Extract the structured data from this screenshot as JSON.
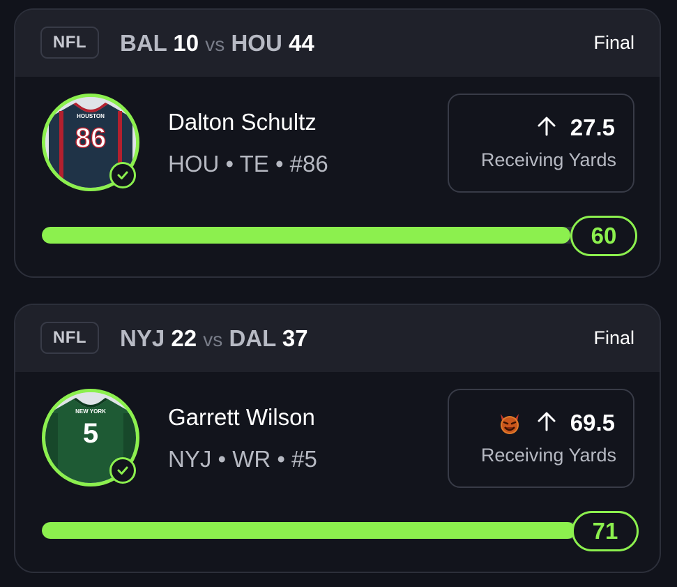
{
  "picks": [
    {
      "league": "NFL",
      "away_team": "BAL",
      "away_score": "10",
      "vs": "vs",
      "home_team": "HOU",
      "home_score": "44",
      "status": "Final",
      "player_name": "Dalton Schultz",
      "player_meta": "HOU • TE • #86",
      "jersey_text": "HOUSTON",
      "jersey_number": "86",
      "jersey_color": "#1f3347",
      "direction_icon": "arrow-up-icon",
      "line": "27.5",
      "stat": "Receiving Yards",
      "result": "60",
      "progress": 0.96,
      "has_emoji": false
    },
    {
      "league": "NFL",
      "away_team": "NYJ",
      "away_score": "22",
      "vs": "vs",
      "home_team": "DAL",
      "home_score": "37",
      "status": "Final",
      "player_name": "Garrett Wilson",
      "player_meta": "NYJ • WR • #5",
      "jersey_text": "NEW YORK",
      "jersey_number": "5",
      "jersey_color": "#1e5a34",
      "direction_icon": "arrow-up-icon",
      "line": "69.5",
      "stat": "Receiving Yards",
      "result": "71",
      "progress": 0.97,
      "has_emoji": true,
      "emoji_icon": "devil-emoji-icon"
    }
  ],
  "colors": {
    "accent": "#8cf04e",
    "background": "#11131b",
    "header": "#1f212a",
    "border": "#2c2f3a"
  }
}
